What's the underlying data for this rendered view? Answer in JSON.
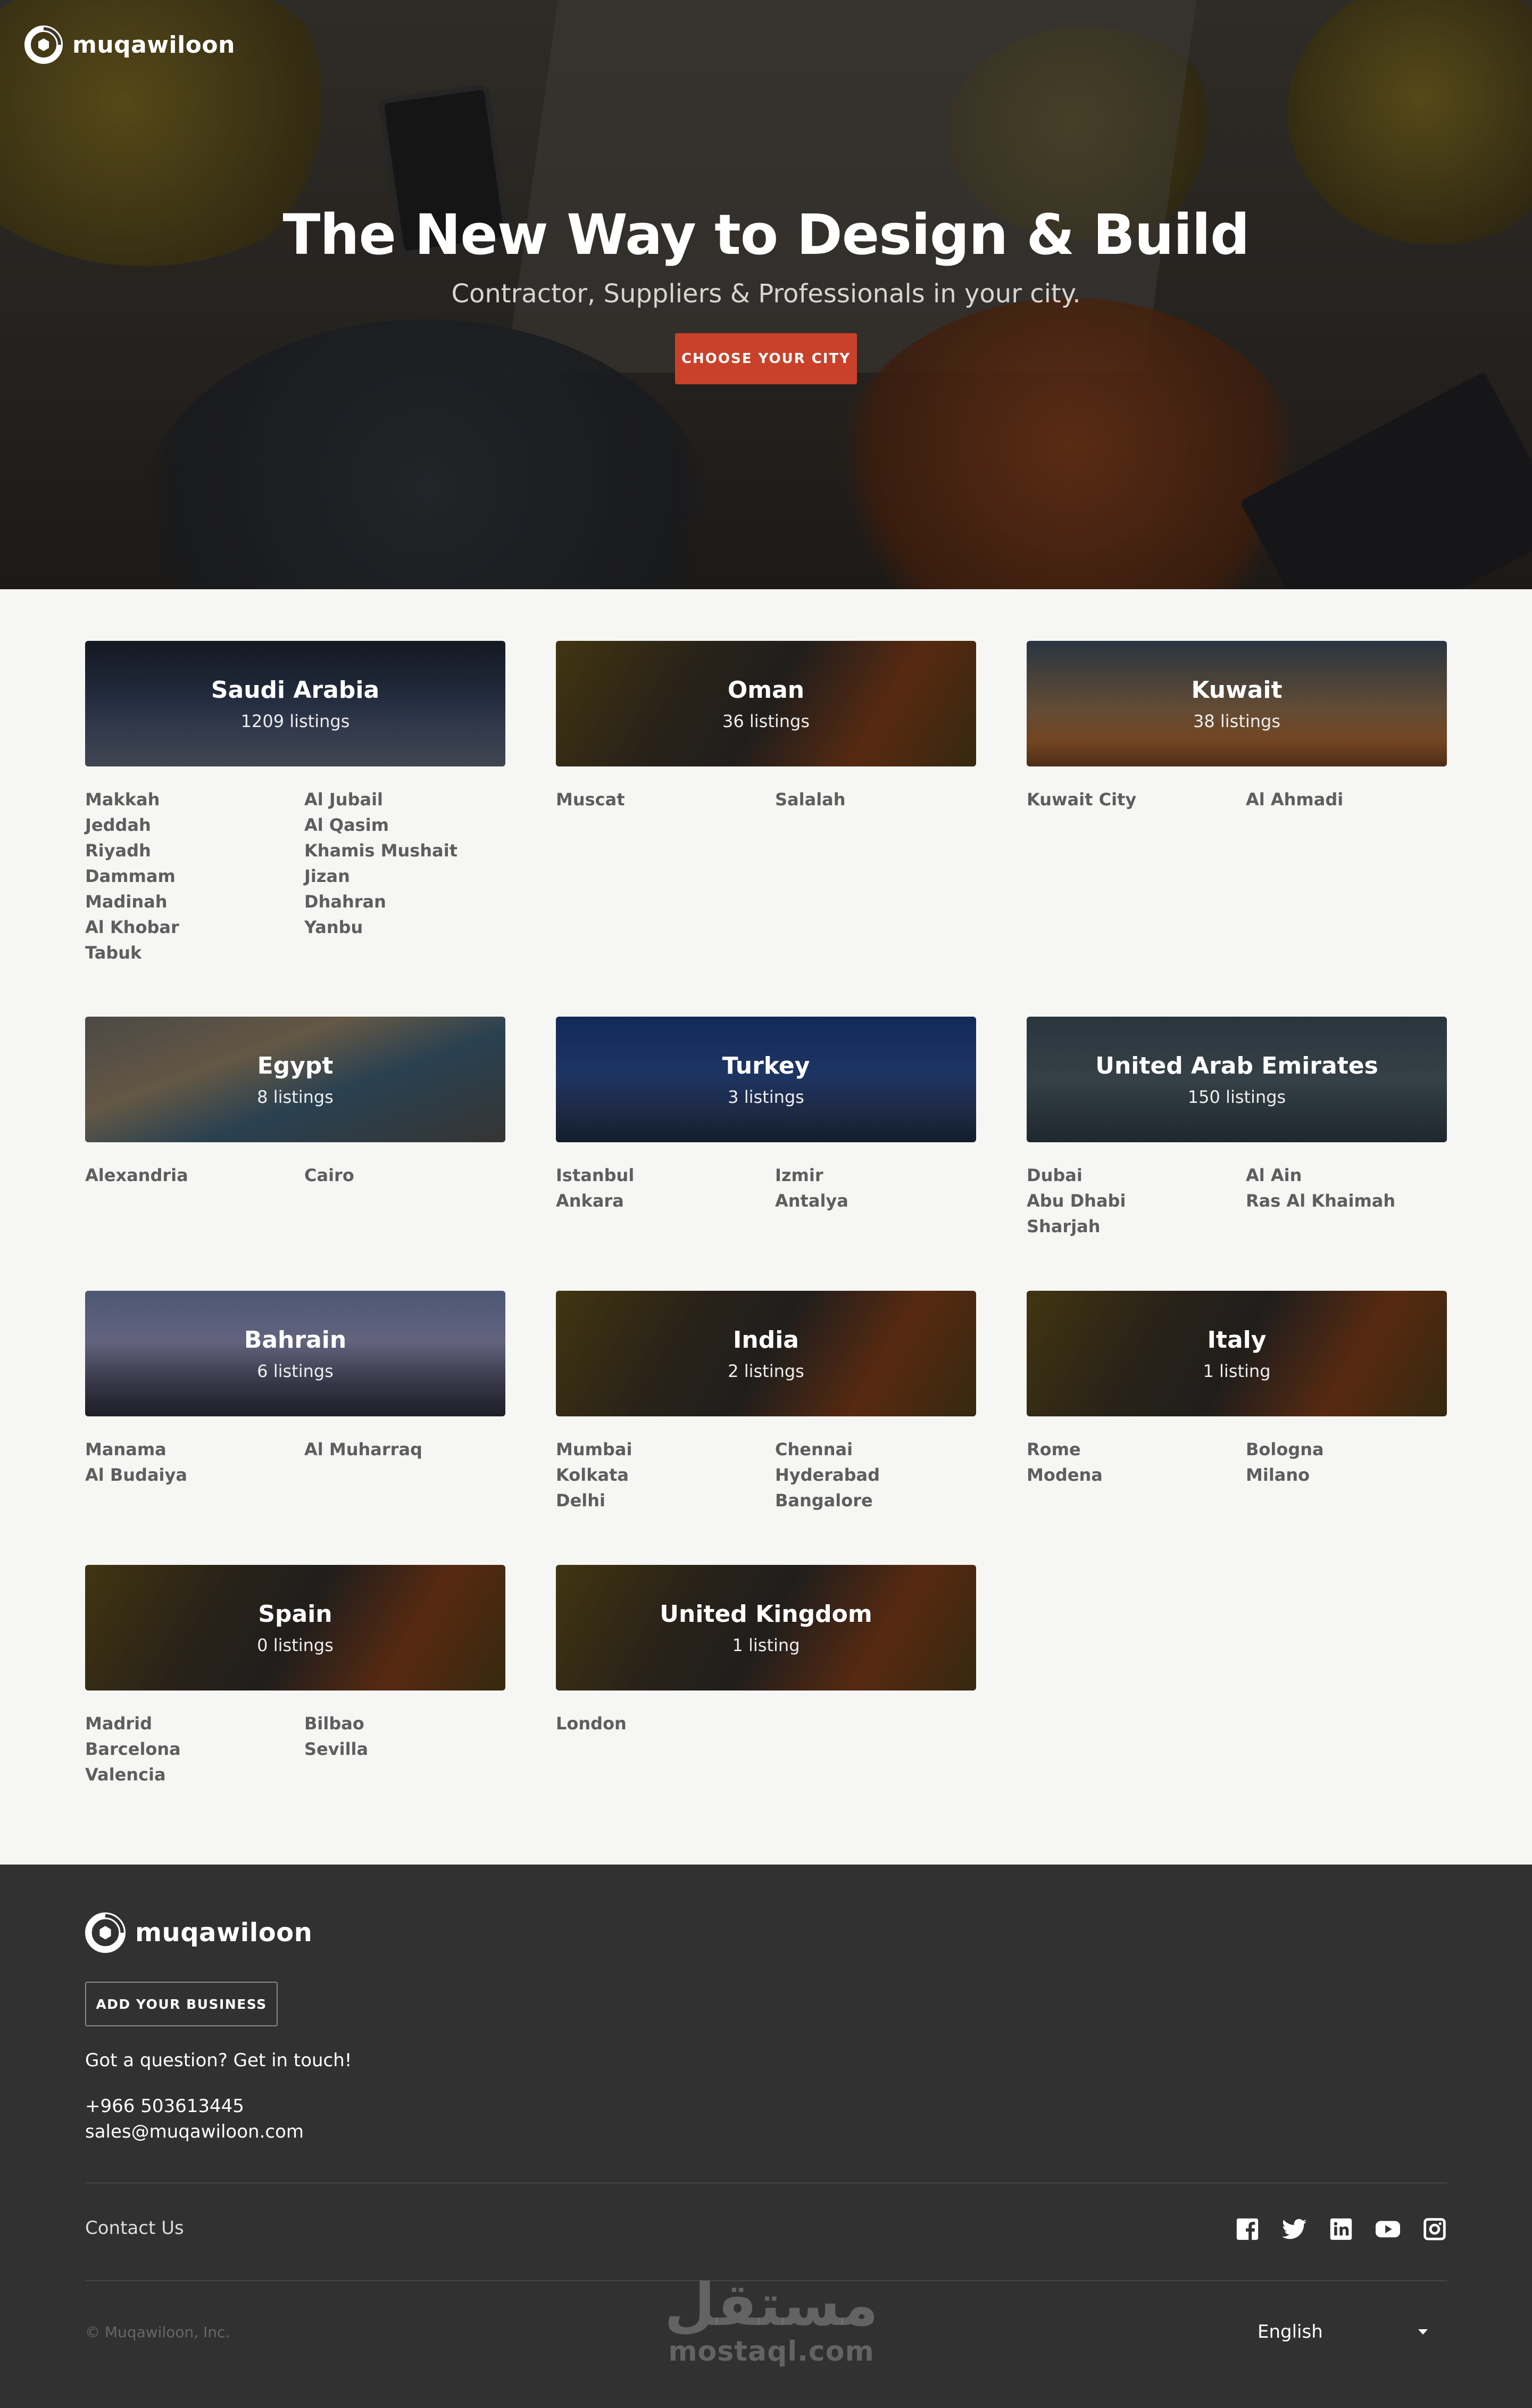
{
  "brand": {
    "name": "muqawiloon"
  },
  "hero": {
    "title": "The New Way to Design & Build",
    "subtitle": "Contractor, Suppliers & Professionals in your city.",
    "cta_label": "CHOOSE YOUR CITY"
  },
  "countries": [
    {
      "name": "Saudi Arabia",
      "listings": "1209 listings",
      "cities_col1": [
        "Makkah",
        "Jeddah",
        "Riyadh",
        "Dammam",
        "Madinah",
        "Al Khobar",
        "Tabuk"
      ],
      "cities_col2": [
        "Al Jubail",
        "Al Qasim",
        "Khamis Mushait",
        "Jizan",
        "Dhahran",
        "Yanbu"
      ]
    },
    {
      "name": "Oman",
      "listings": "36 listings",
      "cities_col1": [
        "Muscat"
      ],
      "cities_col2": [
        "Salalah"
      ]
    },
    {
      "name": "Kuwait",
      "listings": "38 listings",
      "cities_col1": [
        "Kuwait City"
      ],
      "cities_col2": [
        "Al Ahmadi"
      ]
    },
    {
      "name": "Egypt",
      "listings": "8 listings",
      "cities_col1": [
        "Alexandria"
      ],
      "cities_col2": [
        "Cairo"
      ]
    },
    {
      "name": "Turkey",
      "listings": "3 listings",
      "cities_col1": [
        "Istanbul",
        "Ankara"
      ],
      "cities_col2": [
        "Izmir",
        "Antalya"
      ]
    },
    {
      "name": "United Arab Emirates",
      "listings": "150 listings",
      "cities_col1": [
        "Dubai",
        "Abu Dhabi",
        "Sharjah"
      ],
      "cities_col2": [
        "Al Ain",
        "Ras Al Khaimah"
      ]
    },
    {
      "name": "Bahrain",
      "listings": "6 listings",
      "cities_col1": [
        "Manama",
        "Al Budaiya"
      ],
      "cities_col2": [
        "Al Muharraq"
      ]
    },
    {
      "name": "India",
      "listings": "2 listings",
      "cities_col1": [
        "Mumbai",
        "Kolkata",
        "Delhi"
      ],
      "cities_col2": [
        "Chennai",
        "Hyderabad",
        "Bangalore"
      ]
    },
    {
      "name": "Italy",
      "listings": "1 listing",
      "cities_col1": [
        "Rome",
        "Modena"
      ],
      "cities_col2": [
        "Bologna",
        "Milano"
      ]
    },
    {
      "name": "Spain",
      "listings": "0 listings",
      "cities_col1": [
        "Madrid",
        "Barcelona",
        "Valencia"
      ],
      "cities_col2": [
        "Bilbao",
        "Sevilla"
      ]
    },
    {
      "name": "United Kingdom",
      "listings": "1 listing",
      "cities_col1": [
        "London"
      ],
      "cities_col2": []
    }
  ],
  "footer": {
    "add_business_label": "ADD YOUR BUSINESS",
    "question": "Got a question? Get in touch!",
    "phone": "+966 503613445",
    "email": "sales@muqawiloon.com",
    "contact_link": "Contact Us",
    "socials": [
      "facebook-icon",
      "twitter-icon",
      "linkedin-icon",
      "youtube-icon",
      "instagram-icon"
    ],
    "copyright": "© Muqawiloon, Inc.",
    "language": "English"
  },
  "watermark": {
    "arabic": "مستقل",
    "latin": "mostaql.com"
  },
  "colors": {
    "accent": "#c9412a",
    "footer_bg": "#313131",
    "page_bg": "#f6f6f4"
  }
}
